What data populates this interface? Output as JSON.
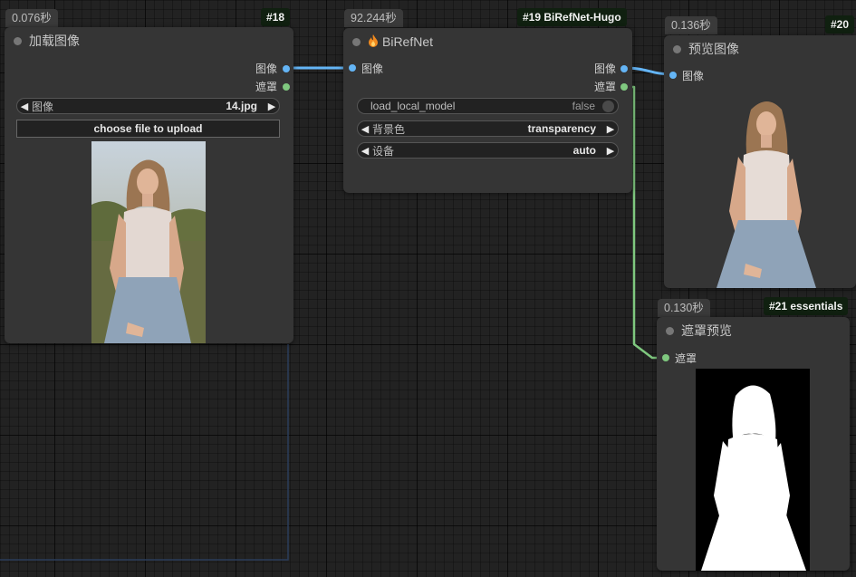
{
  "nodes": {
    "load_image": {
      "time": "0.076秒",
      "id": "#18",
      "title": "加载图像",
      "outputs": [
        "图像",
        "遮罩"
      ],
      "image_widget": {
        "label": "图像",
        "value": "14.jpg"
      },
      "upload_label": "choose file to upload"
    },
    "birefnet": {
      "time": "92.244秒",
      "id": "#19 BiRefNet-Hugo",
      "title": "BiRefNet",
      "input": "图像",
      "outputs": [
        "图像",
        "遮罩"
      ],
      "widgets": [
        {
          "label": "load_local_model",
          "value": "false",
          "type": "toggle"
        },
        {
          "label": "背景色",
          "value": "transparency",
          "type": "combo"
        },
        {
          "label": "设备",
          "value": "auto",
          "type": "combo"
        }
      ]
    },
    "preview_image": {
      "time": "0.136秒",
      "id": "#20",
      "title": "预览图像",
      "input": "图像"
    },
    "mask_preview": {
      "time": "0.130秒",
      "id": "#21 essentials",
      "title": "遮罩预览",
      "input": "遮罩"
    }
  },
  "colors": {
    "image_link": "#64b5f6",
    "mask_link": "#7fc87f",
    "node_bg": "#353535",
    "canvas_bg": "#222222"
  },
  "icons": {
    "birefnet_title_icon": "fire-icon",
    "collapse_dot": "circle-dot-icon",
    "combo_arrows": [
      "triangle-left-icon",
      "triangle-right-icon"
    ]
  }
}
